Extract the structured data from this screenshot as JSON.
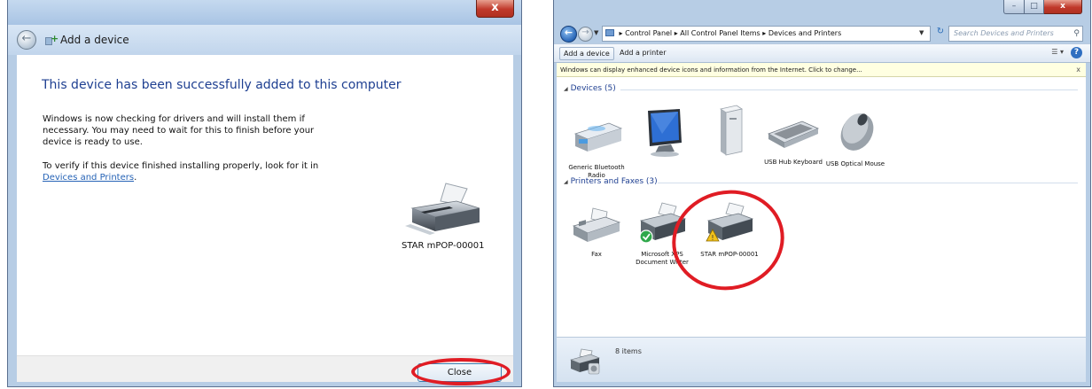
{
  "left_window": {
    "title": "Add a device",
    "heading": "This device has been successfully added to this computer",
    "paragraph1": "Windows is now checking for drivers and will install them if necessary. You may need to wait for this to finish before your device is ready to use.",
    "paragraph2_text": "To verify if this device finished installing properly, look for it in",
    "paragraph2_link": "Devices and Printers",
    "paragraph2_end": ".",
    "device_name": "STAR mPOP-00001",
    "close_button": "Close",
    "title_close_glyph": "x"
  },
  "right_window": {
    "breadcrumb": [
      "Control Panel",
      "All Control Panel Items",
      "Devices and Printers"
    ],
    "breadcrumb_sep": "▸",
    "search_placeholder": "Search Devices and Printers",
    "toolbar": {
      "add_device": "Add a device",
      "add_printer": "Add a printer"
    },
    "infobar": "Windows can display enhanced device icons and information from the Internet. Click to change...",
    "infobar_close": "x",
    "devices_group": "Devices (5)",
    "devices": [
      {
        "label": "Generic Bluetooth Radio",
        "icon": "bluetooth-radio-icon"
      },
      {
        "label": "",
        "icon": "monitor-icon"
      },
      {
        "label": "",
        "icon": "pc-tower-icon"
      },
      {
        "label": "USB Hub Keyboard",
        "icon": "keyboard-icon"
      },
      {
        "label": "USB Optical Mouse",
        "icon": "mouse-icon"
      }
    ],
    "printers_group": "Printers and Faxes (3)",
    "printers": [
      {
        "label": "Fax",
        "icon": "fax-icon",
        "badge": ""
      },
      {
        "label": "Microsoft XPS Document Writer",
        "icon": "printer-icon",
        "badge": "default-check"
      },
      {
        "label": "STAR mPOP-00001",
        "icon": "printer-icon",
        "badge": "warning"
      }
    ],
    "status_count": "8 items"
  },
  "colors": {
    "heading_blue": "#1e3f91",
    "link_blue": "#2663b6",
    "highlight_red": "#e01c24",
    "chrome_blue": "#b7cde5",
    "infobar_yellow": "#ffffe1"
  }
}
